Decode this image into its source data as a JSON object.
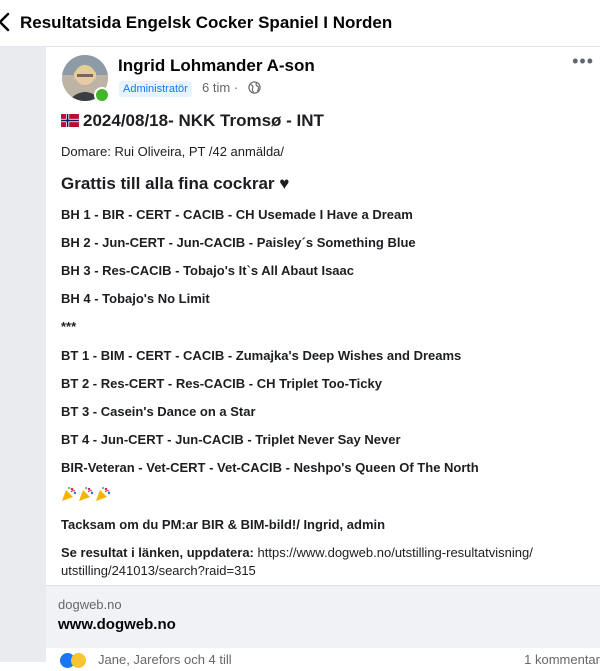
{
  "header": {
    "title": "Resultatsida Engelsk Cocker Spaniel I Norden"
  },
  "post": {
    "author": "Ingrid Lohmander A-son",
    "badge": "Administratör",
    "time": "6 tim ·",
    "headline": "2024/08/18- NKK Tromsø - INT",
    "judge": "Domare: Rui Oliveira, PT /42 anmälda/",
    "greeting": "Grattis till alla fina cockrar ♥",
    "results": [
      "BH 1 - BIR - CERT - CACIB - CH Usemade I Have a Dream",
      "BH 2 - Jun-CERT - Jun-CACIB - Paisley´s Something Blue",
      "BH 3 - Res-CACIB - Tobajo's It`s All Abaut Isaac",
      "BH 4 - Tobajo's No Limit",
      "***",
      "BT 1 - BIM - CERT - CACIB - Zumajka's Deep Wishes and Dreams",
      "BT 2 - Res-CERT - Res-CACIB - CH Triplet Too-Ticky",
      "BT 3 - Casein's Dance on a Star",
      "BT 4 - Jun-CERT - Jun-CACIB - Triplet Never Say Never",
      "BIR-Veteran - Vet-CERT - Vet-CACIB - Neshpo's Queen Of The North"
    ],
    "thanks": "Tacksam om du PM:ar BIR & BIM-bild!/ Ingrid, admin",
    "link_label": "Se resultat i länken, uppdatera:",
    "link_url_1": "https://www.dogweb.no/utstilling-resultatvisning/",
    "link_url_2": "utstilling/241013/search?raid=315"
  },
  "link_card": {
    "domain": "dogweb.no",
    "title": "www.dogweb.no"
  },
  "footer": {
    "reactors": "Jane, Jarefors och 4 till",
    "comments": "1 kommentar"
  },
  "icons": {
    "flag": "norway-flag-icon",
    "party": "party-popper-icon",
    "globe": "globe-icon",
    "more": "more-options-icon"
  },
  "colors": {
    "badge_bg": "#e7f3ff",
    "badge_text": "#1877f2",
    "online": "#42b72a",
    "link_card_bg": "#f0f2f5"
  }
}
